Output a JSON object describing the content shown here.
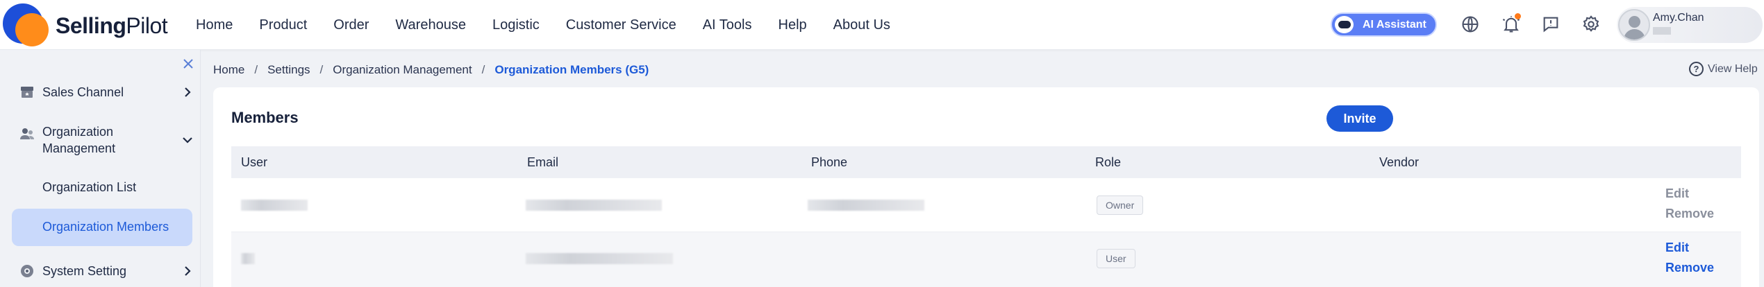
{
  "brand": {
    "name_bold": "Selling",
    "name_regular": "Pilot"
  },
  "nav": [
    {
      "label": "Home"
    },
    {
      "label": "Product"
    },
    {
      "label": "Order"
    },
    {
      "label": "Warehouse"
    },
    {
      "label": "Logistic"
    },
    {
      "label": "Customer Service"
    },
    {
      "label": "AI Tools"
    },
    {
      "label": "Help"
    },
    {
      "label": "About Us"
    }
  ],
  "toolbar": {
    "ai_assistant_label": "AI Assistant",
    "icons": [
      "globe-icon",
      "bell-icon",
      "feedback-icon",
      "gear-icon"
    ],
    "notification_dot_color": "#ff7a1a"
  },
  "user": {
    "name": "Amy.Chan"
  },
  "sidebar": {
    "items": [
      {
        "label": "Sales Channel",
        "icon": "store-icon",
        "expanded": false
      },
      {
        "label_line1": "Organization",
        "label_line2": "Management",
        "icon": "people-icon",
        "expanded": true,
        "children": [
          {
            "label": "Organization List",
            "active": false
          },
          {
            "label": "Organization Members",
            "active": true
          }
        ]
      },
      {
        "label": "System Setting",
        "icon": "gear-icon",
        "expanded": false
      }
    ]
  },
  "breadcrumb": {
    "items": [
      "Home",
      "Settings",
      "Organization Management"
    ],
    "current": "Organization Members (G5)"
  },
  "help": {
    "label": "View Help"
  },
  "members": {
    "title": "Members",
    "invite_label": "Invite",
    "columns": [
      "User",
      "Email",
      "Phone",
      "Role",
      "Vendor"
    ],
    "rows": [
      {
        "role": "Owner",
        "actions": [
          "Edit",
          "Remove"
        ],
        "actions_enabled": false
      },
      {
        "role": "User",
        "actions": [
          "Edit",
          "Remove"
        ],
        "actions_enabled": true
      }
    ]
  },
  "colors": {
    "accent": "#1d5ad8",
    "active_bg": "#c9d9fb",
    "logo_blue": "#1d4fd8",
    "logo_orange": "#ff8c1a",
    "ai_button": "#5b7ef5"
  }
}
